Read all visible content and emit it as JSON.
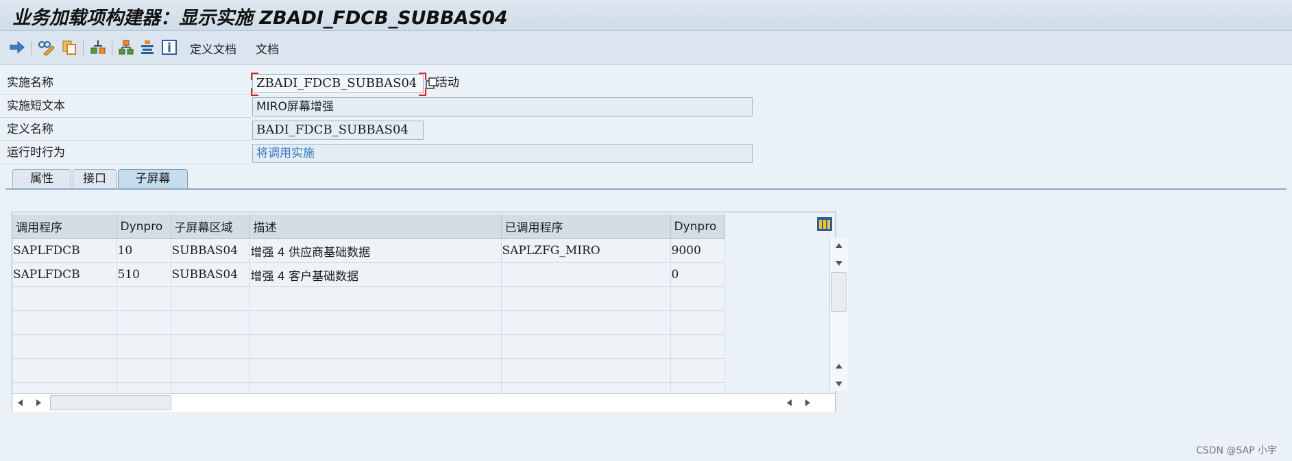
{
  "window": {
    "title": "业务加载项构建器：显示实施 ZBADI_FDCB_SUBBAS04"
  },
  "toolbar": {
    "icons": [
      "arrow-right-icon",
      "display-change-icon",
      "object-copy-icon",
      "other-object-icon",
      "hierarchy-icon",
      "text-align-icon",
      "info-icon"
    ],
    "define_doc_label": "定义文档",
    "doc_label": "文档"
  },
  "form": {
    "impl_name_label": "实施名称",
    "impl_name_value": "ZBADI_FDCB_SUBBAS04",
    "status": "活动",
    "short_text_label": "实施短文本",
    "short_text_value": "MIRO屏幕增强",
    "def_name_label": "定义名称",
    "def_name_value": "BADI_FDCB_SUBBAS04",
    "runtime_label": "运行时行为",
    "runtime_value": "将调用实施"
  },
  "tabs": [
    "属性",
    "接口",
    "子屏幕"
  ],
  "active_tab": "子屏幕",
  "grid": {
    "columns": [
      "调用程序",
      "Dynpro",
      "子屏幕区域",
      "描述",
      "已调用程序",
      "Dynpro"
    ],
    "rows": [
      [
        "SAPLFDCB",
        "10",
        "SUBBAS04",
        "增强 4 供应商基础数据",
        "SAPLZFG_MIRO",
        "9000"
      ],
      [
        "SAPLFDCB",
        "510",
        "SUBBAS04",
        "增强 4 客户基础数据",
        "",
        "0"
      ],
      [
        "",
        "",
        "",
        "",
        "",
        ""
      ],
      [
        "",
        "",
        "",
        "",
        "",
        ""
      ],
      [
        "",
        "",
        "",
        "",
        "",
        ""
      ],
      [
        "",
        "",
        "",
        "",
        "",
        ""
      ],
      [
        "",
        "",
        "",
        "",
        "",
        ""
      ]
    ]
  },
  "watermark": "CSDN @SAP 小宇",
  "colors": {
    "accent": "#3a78c3",
    "focus": "#d8202a",
    "background": "#eaf1f7"
  }
}
